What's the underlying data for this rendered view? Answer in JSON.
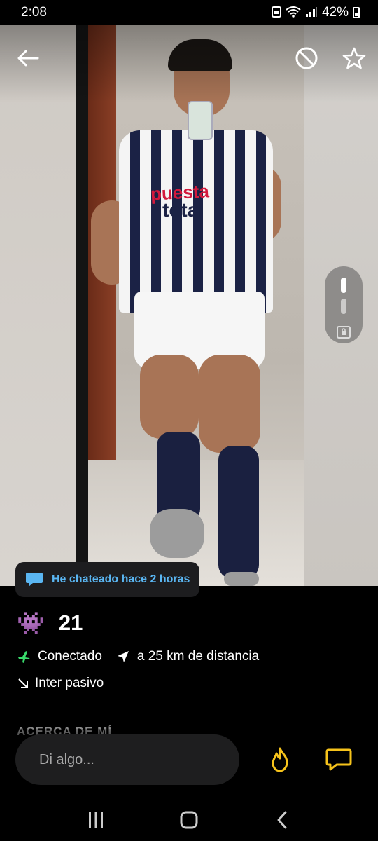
{
  "status_bar": {
    "time": "2:08",
    "battery": "42%"
  },
  "header": {
    "back_icon": "arrow-left-icon",
    "block_icon": "block-icon",
    "favorite_icon": "star-icon"
  },
  "photo_pager": {
    "total_photos": 2,
    "current_photo": 1,
    "has_private_album": true
  },
  "chat_badge": {
    "text": "He chateado hace 2 horas",
    "icon": "chat-bubble-icon",
    "color": "#5ab6f2"
  },
  "profile": {
    "emoji": "👾",
    "age": "21",
    "online_status": "Conectado",
    "distance": "a 25 km de distancia",
    "position": "Inter pasivo",
    "about_heading": "ACERCA DE MÍ",
    "online_color": "#38d96b",
    "jersey_text_1": "puesta",
    "jersey_text_2": "total"
  },
  "composer": {
    "placeholder": "Di algo...",
    "tap_icon": "flame-icon",
    "message_icon": "message-icon",
    "accent": "#f6c31b"
  },
  "nav_bar": {
    "recent_icon": "recent-apps-icon",
    "home_icon": "home-icon",
    "back_icon": "nav-back-icon"
  }
}
